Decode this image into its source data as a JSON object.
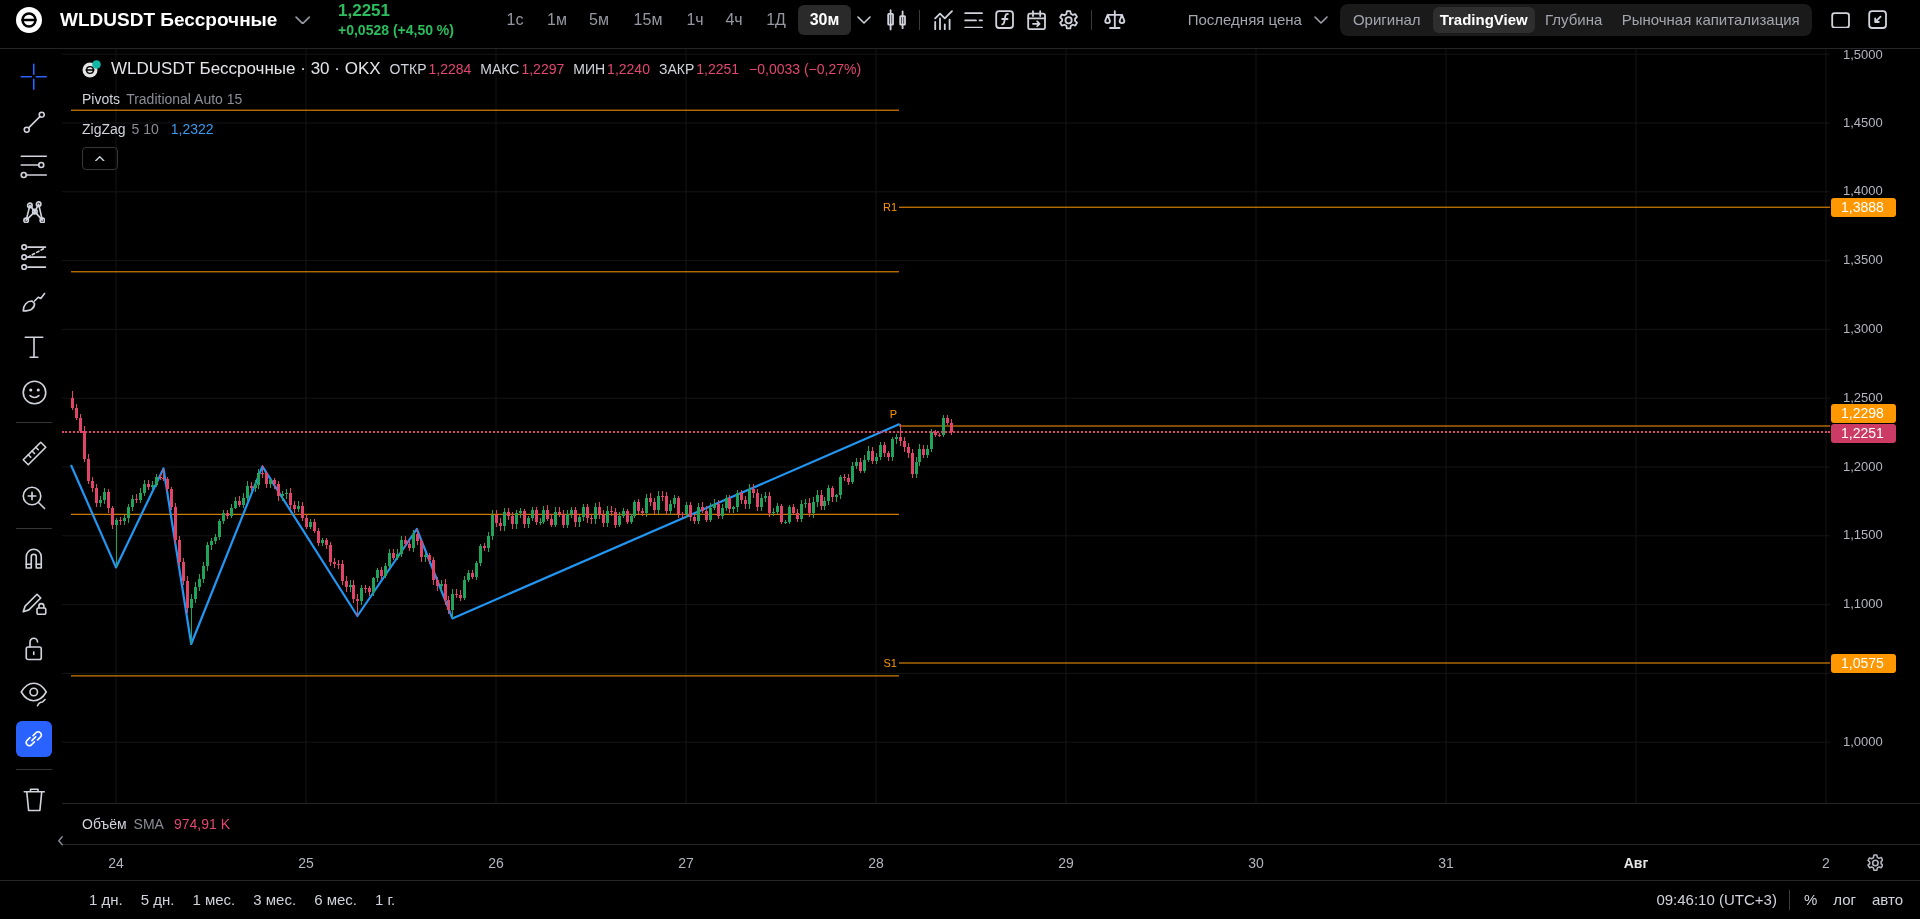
{
  "header": {
    "symbol": "WLDUSDT Бессрочные",
    "last_price": "1,2251",
    "change": "+0,0528 (+4,50 %)",
    "intervals": [
      {
        "label": "1с",
        "selected": false
      },
      {
        "label": "1м",
        "selected": false
      },
      {
        "label": "5м",
        "selected": false
      },
      {
        "label": "15м",
        "selected": false
      },
      {
        "label": "1ч",
        "selected": false
      },
      {
        "label": "4ч",
        "selected": false
      },
      {
        "label": "1Д",
        "selected": false
      },
      {
        "label": "30м",
        "selected": true
      }
    ],
    "price_source": "Последняя цена",
    "views": [
      {
        "label": "Оригинал",
        "selected": false
      },
      {
        "label": "TradingView",
        "selected": true
      },
      {
        "label": "Глубина",
        "selected": false
      },
      {
        "label": "Рыночная капитализация",
        "selected": false
      }
    ]
  },
  "left_toolbar": {
    "drawing_tools": [
      {
        "kind": "crosshair",
        "selected": true
      },
      {
        "kind": "trend-line",
        "selected": false
      },
      {
        "kind": "horizontal-lines",
        "selected": false
      },
      {
        "kind": "pattern",
        "selected": false
      },
      {
        "kind": "fib",
        "selected": false
      },
      {
        "kind": "brush",
        "selected": false
      },
      {
        "kind": "text",
        "selected": false
      },
      {
        "kind": "emoji",
        "selected": false
      }
    ],
    "measure_tools": [
      {
        "kind": "ruler",
        "selected": false
      },
      {
        "kind": "zoom-in",
        "selected": false
      }
    ],
    "toggles": [
      {
        "kind": "magnet",
        "on": false
      },
      {
        "kind": "lock-drawings",
        "on": false
      },
      {
        "kind": "lock",
        "on": false
      },
      {
        "kind": "hide",
        "on": false
      },
      {
        "kind": "sync",
        "on": true
      }
    ]
  },
  "chart": {
    "legend": {
      "title": "WLDUSDT Бессрочные · 30 · OKX",
      "ohlc": [
        {
          "label": "ОТКР",
          "value": "1,2284"
        },
        {
          "label": "МАКС",
          "value": "1,2297"
        },
        {
          "label": "МИН",
          "value": "1,2240"
        },
        {
          "label": "ЗАКР",
          "value": "1,2251"
        }
      ],
      "change": "−0,0033 (−0,27%)"
    },
    "indicators": [
      {
        "name": "Pivots",
        "params": "Traditional Auto 15"
      },
      {
        "name": "ZigZag",
        "params": "5 10",
        "value": "1,2322"
      }
    ],
    "pivot_labels": [
      "R1",
      "P",
      "S1"
    ],
    "price_axis": [
      "1,5000",
      "1,4500",
      "1,4000",
      "1,3500",
      "1,3000",
      "1,2500",
      "1,2000",
      "1,1500",
      "1,1000",
      "1,0000"
    ],
    "price_badges": [
      {
        "value": "1,3888",
        "color": "#ff9800"
      },
      {
        "value": "1,2298",
        "color": "#ff9800"
      },
      {
        "value": "1,2251",
        "color": "#cc3b63"
      },
      {
        "value": "1,0575",
        "color": "#ff9800"
      }
    ],
    "volume_legend": {
      "name": "Объём",
      "params": "SMA",
      "value": "974,91 K"
    },
    "time_axis": [
      {
        "label": "24",
        "kind": "day"
      },
      {
        "label": "25",
        "kind": "day"
      },
      {
        "label": "26",
        "kind": "day"
      },
      {
        "label": "27",
        "kind": "day"
      },
      {
        "label": "28",
        "kind": "day"
      },
      {
        "label": "29",
        "kind": "day"
      },
      {
        "label": "30",
        "kind": "day"
      },
      {
        "label": "31",
        "kind": "day"
      },
      {
        "label": "Авг",
        "kind": "month"
      },
      {
        "label": "2",
        "kind": "day"
      }
    ]
  },
  "bottom_bar": {
    "ranges": [
      "1 дн.",
      "5 дн.",
      "1 мес.",
      "3 мес.",
      "6 мес.",
      "1 г."
    ],
    "clock": "09:46:10 (UTC+3)",
    "scale_modes": [
      "%",
      "лог",
      "авто"
    ]
  }
}
